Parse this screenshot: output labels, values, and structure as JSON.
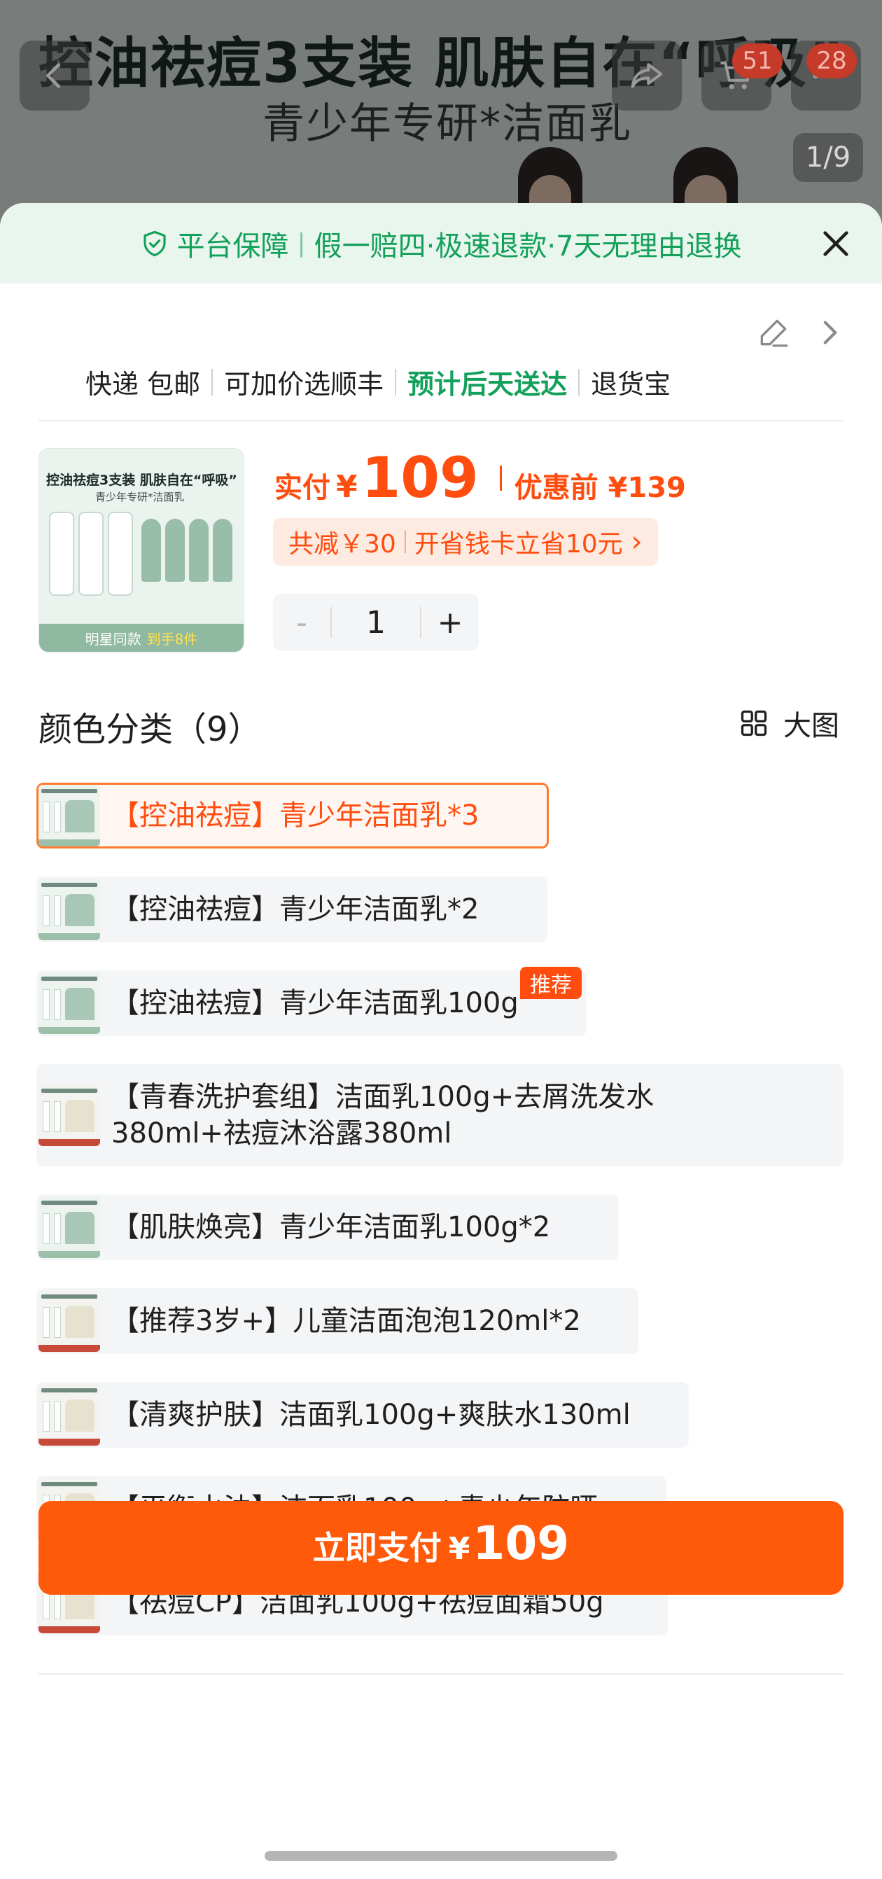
{
  "background": {
    "title": "控油祛痘3支装 肌肤自在“呼吸”",
    "subtitle": "青少年专研*洁面乳",
    "message_badge": "51",
    "cart_badge": "28",
    "image_counter": "1/9"
  },
  "guarantee": {
    "title": "平台保障",
    "separator": "|",
    "text": "假一赔四·极速退款·7天无理由退换"
  },
  "delivery": {
    "items": [
      "快递 包邮",
      "可加价选顺丰",
      "预计后天送达",
      "退货宝"
    ]
  },
  "product": {
    "thumb_title": "控油祛痘3支装 肌肤自在“呼吸”",
    "thumb_subtitle": "青少年专研*洁面乳",
    "thumb_footer": "明星同款",
    "thumb_footer_highlight": "到手8件",
    "price_label": "实付",
    "currency": "¥",
    "price": "109",
    "before_label": "优惠前 ¥139",
    "savings_text": "共减￥30",
    "card_text": "开省钱卡立省10元",
    "chevron": "›",
    "quantity": "1",
    "minus": "-",
    "plus": "+"
  },
  "variants": {
    "heading": "颜色分类（9）",
    "big_picture_label": "大图",
    "recommend_badge": "推荐",
    "options": [
      {
        "label": "【控油祛痘】青少年洁面乳*3"
      },
      {
        "label": "【控油祛痘】青少年洁面乳*2"
      },
      {
        "label": "【控油祛痘】青少年洁面乳100g"
      },
      {
        "label": "【青春洗护套组】洁面乳100g+去屑洗发水380ml+祛痘沐浴露380ml"
      },
      {
        "label": "【肌肤焕亮】青少年洁面乳100g*2"
      },
      {
        "label": "【推荐3岁+】儿童洁面泡泡120ml*2"
      },
      {
        "label": "【清爽护肤】洁面乳100g+爽肤水130ml"
      },
      {
        "label": "【平衡水油】洁面乳100g+青少年防晒"
      },
      {
        "label": "【祛痘CP】洁面乳100g+祛痘面霜50g"
      }
    ]
  },
  "pay_button": {
    "label": "立即支付",
    "currency": "¥",
    "amount": "109"
  },
  "colors": {
    "accent": "#ff5a0a",
    "price_red": "#ff4d0f",
    "guarantee_green": "#13a05a",
    "guarantee_bg": "#e9f6ee"
  }
}
